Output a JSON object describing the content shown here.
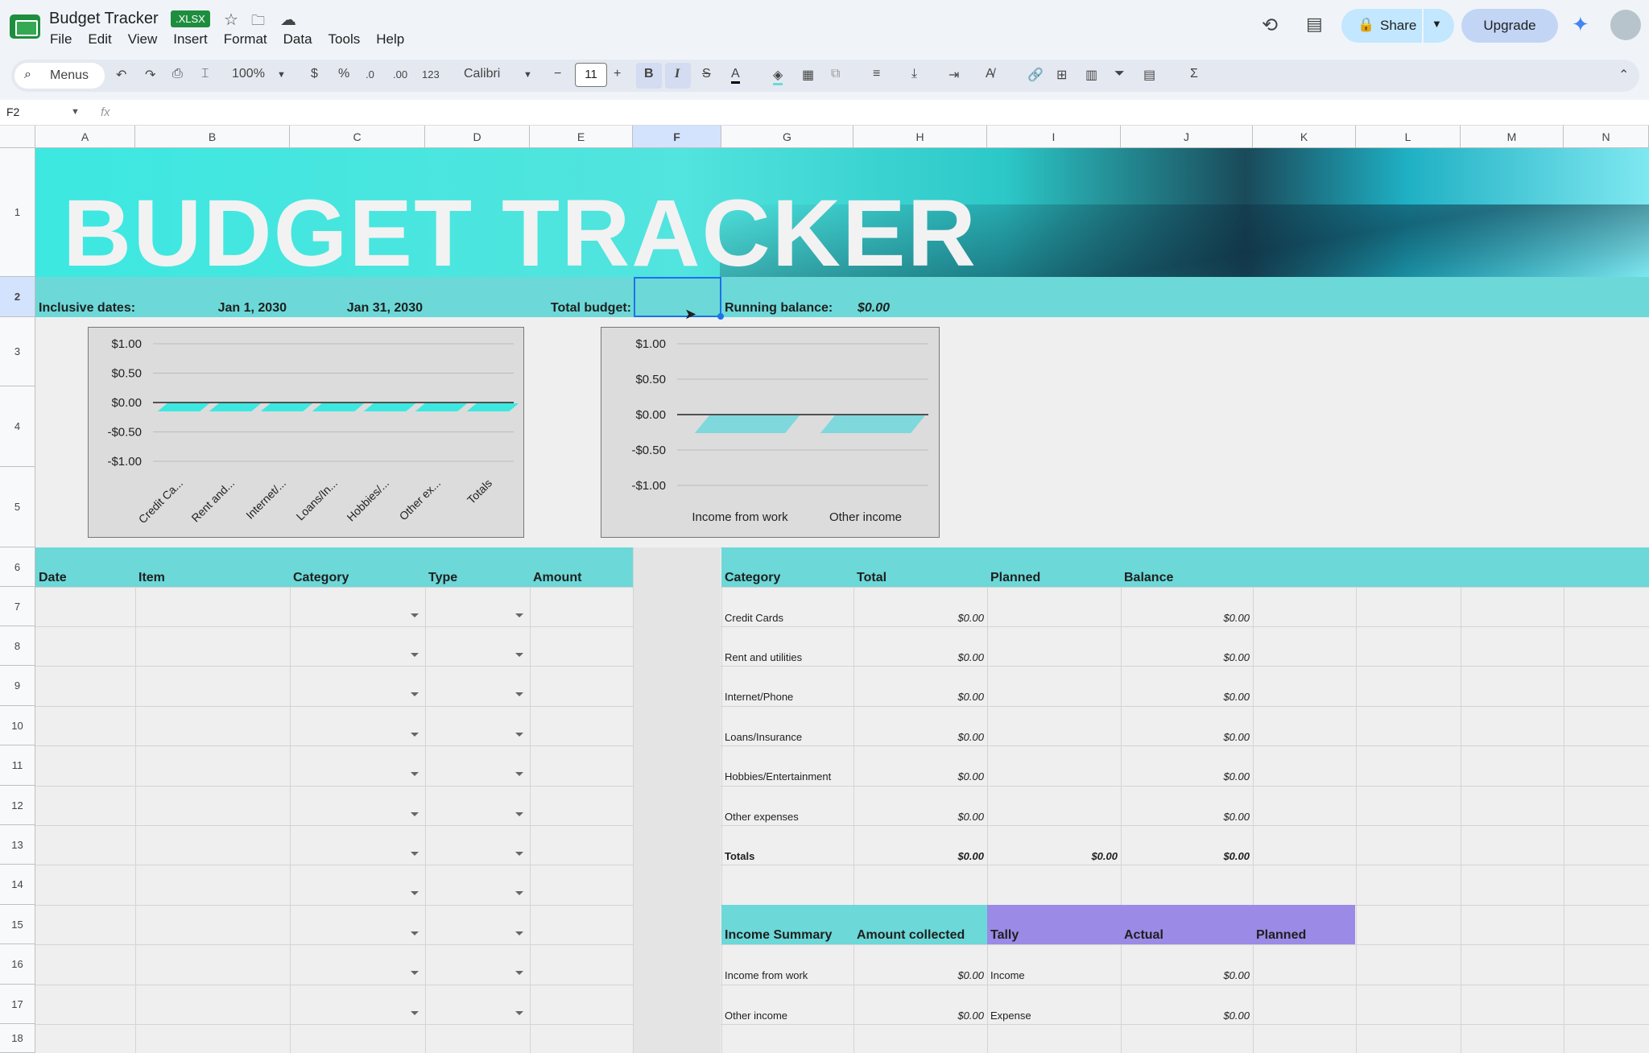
{
  "app": {
    "title": "Budget Tracker",
    "badge": ".XLSX"
  },
  "menu": [
    "File",
    "Edit",
    "View",
    "Insert",
    "Format",
    "Data",
    "Tools",
    "Help"
  ],
  "header_buttons": {
    "share": "Share",
    "upgrade": "Upgrade"
  },
  "toolbar": {
    "search": "Menus",
    "zoom": "100%",
    "currency": "$",
    "percent": "%",
    "dec_less": ".0",
    "dec_more": ".00",
    "number_fmt": "123",
    "font": "Calibri",
    "font_size": "11"
  },
  "formula_bar": {
    "cell_ref": "F2",
    "fx": "fx",
    "value": ""
  },
  "columns": [
    "A",
    "B",
    "C",
    "D",
    "E",
    "F",
    "G",
    "H",
    "I",
    "J",
    "K",
    "L",
    "M",
    "N"
  ],
  "rows": [
    "1",
    "2",
    "3",
    "4",
    "5",
    "6",
    "7",
    "8",
    "9",
    "10",
    "11",
    "12",
    "13",
    "14",
    "15",
    "16",
    "17",
    "18"
  ],
  "banner": {
    "title": "BUDGET TRACKER"
  },
  "row2": {
    "dates_label": "Inclusive dates:",
    "start": "Jan 1, 2030",
    "end": "Jan 31, 2030",
    "budget_label": "Total budget:",
    "balance_label": "Running balance:",
    "balance_value": "$0.00"
  },
  "log_headers": [
    "Date",
    "Item",
    "Category",
    "Type",
    "Amount"
  ],
  "summary_headers": [
    "Category",
    "Total",
    "Planned",
    "Balance"
  ],
  "summary_rows": [
    {
      "category": "Credit Cards",
      "total": "$0.00",
      "planned": "",
      "balance": "$0.00"
    },
    {
      "category": "Rent and utilities",
      "total": "$0.00",
      "planned": "",
      "balance": "$0.00"
    },
    {
      "category": "Internet/Phone",
      "total": "$0.00",
      "planned": "",
      "balance": "$0.00"
    },
    {
      "category": "Loans/Insurance",
      "total": "$0.00",
      "planned": "",
      "balance": "$0.00"
    },
    {
      "category": "Hobbies/Entertainment",
      "total": "$0.00",
      "planned": "",
      "balance": "$0.00"
    },
    {
      "category": "Other expenses",
      "total": "$0.00",
      "planned": "",
      "balance": "$0.00"
    },
    {
      "category": "Totals",
      "total": "$0.00",
      "planned": "$0.00",
      "balance": "$0.00"
    }
  ],
  "income_headers": [
    "Income Summary",
    "Amount collected",
    "Tally",
    "Actual",
    "Planned"
  ],
  "income_rows": [
    {
      "label": "Income from work",
      "amount": "$0.00",
      "tally": "Income",
      "actual": "$0.00"
    },
    {
      "label": "Other income",
      "amount": "$0.00",
      "tally": "Expense",
      "actual": "$0.00"
    }
  ],
  "chart_data": [
    {
      "type": "bar",
      "categories": [
        "Credit Ca...",
        "Rent and...",
        "Internet/...",
        "Loans/In...",
        "Hobbies/...",
        "Other ex...",
        "Totals"
      ],
      "values": [
        0,
        0,
        0,
        0,
        0,
        0,
        0
      ],
      "yticks": [
        "$1.00",
        "$0.50",
        "$0.00",
        "-$0.50",
        "-$1.00"
      ],
      "ylim": [
        -1,
        1
      ],
      "bar_color": "#3de8e0"
    },
    {
      "type": "bar",
      "categories": [
        "Income from work",
        "Other income"
      ],
      "values": [
        0,
        0
      ],
      "yticks": [
        "$1.00",
        "$0.50",
        "$0.00",
        "-$0.50",
        "-$1.00"
      ],
      "ylim": [
        -1,
        1
      ],
      "bar_color": "#7fd8dc"
    }
  ]
}
